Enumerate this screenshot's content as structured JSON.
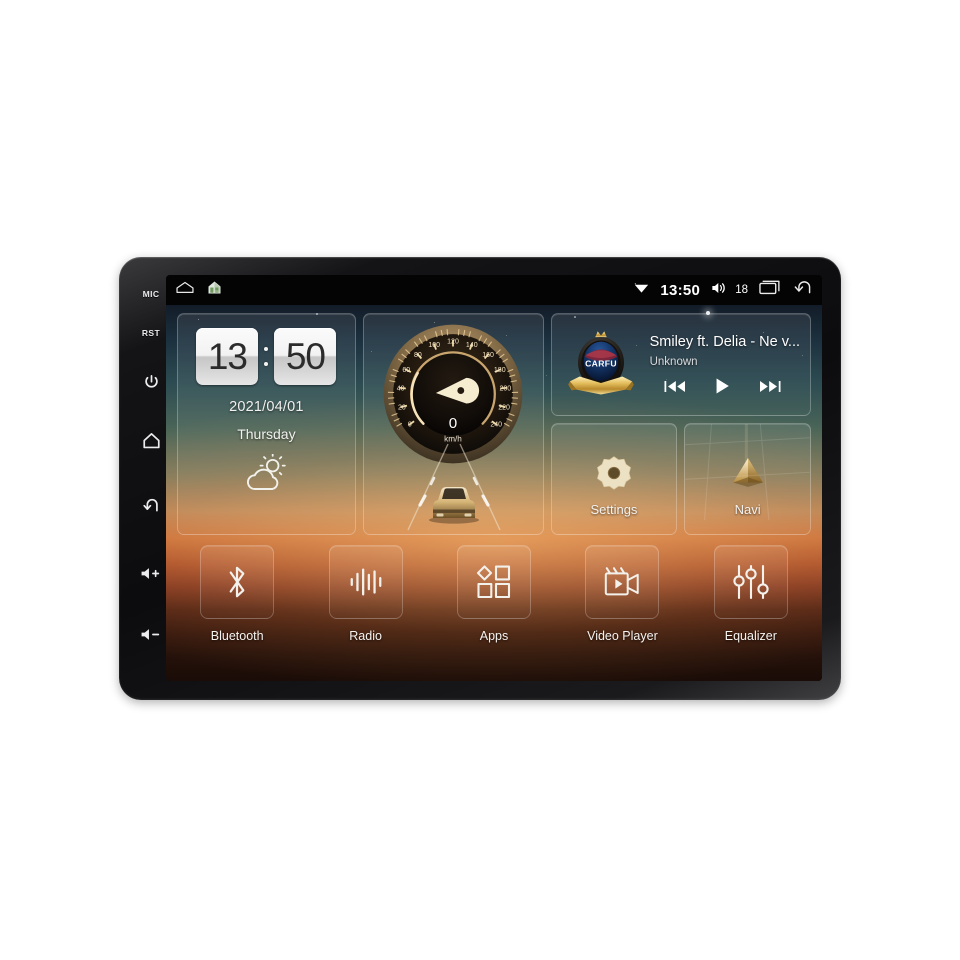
{
  "device": {
    "name": "android-car-head-unit",
    "bezel_keys": [
      {
        "id": "mic",
        "label": "MIC",
        "type": "text"
      },
      {
        "id": "rst",
        "label": "RST",
        "type": "text"
      },
      {
        "id": "power",
        "label": "",
        "type": "icon",
        "icon": "power-icon"
      },
      {
        "id": "home",
        "label": "",
        "type": "icon",
        "icon": "home-icon"
      },
      {
        "id": "back",
        "label": "",
        "type": "icon",
        "icon": "back-arrow-icon"
      },
      {
        "id": "volume-up",
        "label": "",
        "type": "icon",
        "icon": "volume-up-icon"
      },
      {
        "id": "volume-down",
        "label": "",
        "type": "icon",
        "icon": "volume-down-icon"
      }
    ]
  },
  "statusbar": {
    "left_icons": [
      "notification-tray-icon",
      "launcher-house-icon"
    ],
    "wifi_icon": "wifi-icon",
    "time": "13:50",
    "volume_icon": "volume-icon",
    "volume_level": "18",
    "recents_icon": "recent-apps-icon",
    "back_icon": "back-arrow-icon"
  },
  "clock_widget": {
    "hours": "13",
    "minutes": "50",
    "date": "2021/04/01",
    "weekday": "Thursday",
    "weather_icon": "partly-cloudy-icon"
  },
  "speed_widget": {
    "value": "0",
    "unit": "km/h",
    "tick_labels": [
      "0",
      "20",
      "40",
      "60",
      "80",
      "100",
      "120",
      "140",
      "160",
      "180",
      "200",
      "220",
      "240"
    ],
    "min": 0,
    "max": 240,
    "car_icon": "car-on-road-icon"
  },
  "media_widget": {
    "badge_text": "CARFU",
    "title": "Smiley ft. Delia - Ne v...",
    "artist": "Unknown",
    "prev_icon": "previous-track-icon",
    "play_icon": "play-icon",
    "next_icon": "next-track-icon"
  },
  "tiles": [
    {
      "label": "Settings",
      "icon": "gear-icon"
    },
    {
      "label": "Navi",
      "icon": "navigation-arrow-icon"
    }
  ],
  "dock": [
    {
      "label": "Bluetooth",
      "icon": "bluetooth-icon"
    },
    {
      "label": "Radio",
      "icon": "radio-waveform-icon"
    },
    {
      "label": "Apps",
      "icon": "apps-grid-icon"
    },
    {
      "label": "Video Player",
      "icon": "video-player-icon"
    },
    {
      "label": "Equalizer",
      "icon": "equalizer-icon"
    }
  ],
  "colors": {
    "page_background": "#ffffff",
    "bezel": "#121214",
    "statusbar": "#040404",
    "accent_gold": "#d7ab63",
    "text_primary": "#f4f2ef",
    "sky_top": "#121c28",
    "sunset_mid": "#c9743f",
    "ground_bottom": "#1a0c07"
  }
}
